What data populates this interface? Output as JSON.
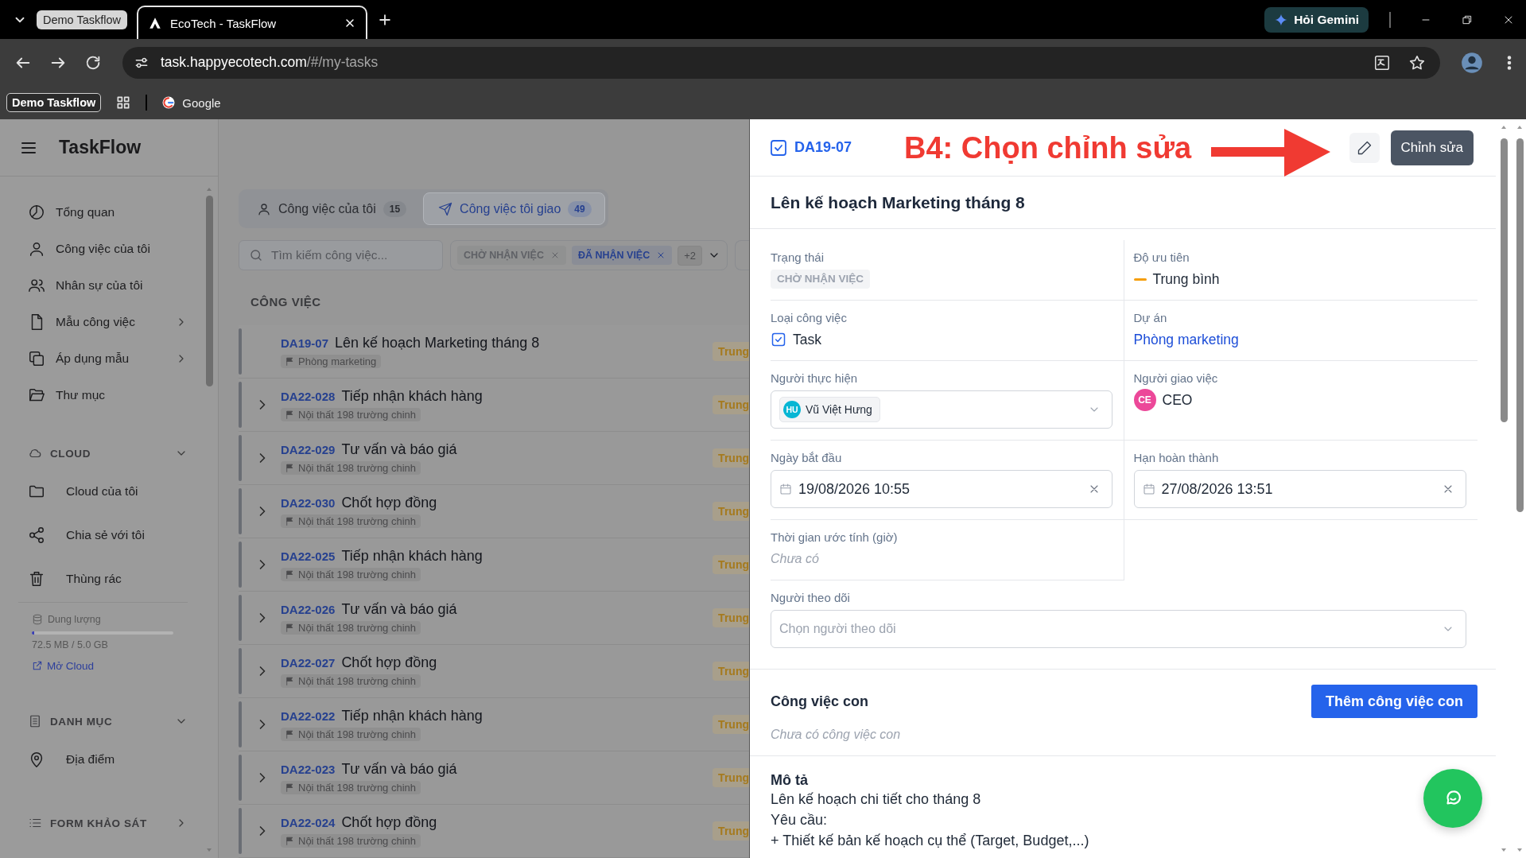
{
  "browser": {
    "tab_group": "Demo Taskflow",
    "tabs": [
      {
        "label": "EcoTech - TaskFlow",
        "selected": true
      }
    ],
    "gemini": "Hỏi Gemini",
    "url_host": "task.happyecotech.com",
    "url_path": "/#/my-tasks",
    "bookmark_group": "Demo Taskflow",
    "bookmarks": [
      {
        "label": "Google"
      }
    ]
  },
  "sidebar": {
    "title": "TaskFlow",
    "items": [
      {
        "label": "Tổng quan",
        "has_submenu": false
      },
      {
        "label": "Công việc của tôi",
        "has_submenu": false
      },
      {
        "label": "Nhân sự của tôi",
        "has_submenu": false
      },
      {
        "label": "Mẫu công việc",
        "has_submenu": true
      },
      {
        "label": "Áp dụng mẫu",
        "has_submenu": true
      },
      {
        "label": "Thư mục",
        "has_submenu": false
      }
    ],
    "cloud": {
      "title": "CLOUD",
      "expanded": true,
      "items": [
        "Cloud của tôi",
        "Chia sẻ với tôi",
        "Thùng rác"
      ],
      "storage": {
        "label": "Dung lượng",
        "level": 0.015,
        "reading": "72.5 MB / 5.0 GB",
        "link": "Mở Cloud"
      }
    },
    "catalog": {
      "title": "DANH MỤC",
      "expanded": true,
      "items": [
        "Địa điểm"
      ]
    },
    "survey": {
      "title": "FORM KHẢO SÁT",
      "expanded": false
    }
  },
  "task_list": {
    "view_tabs": [
      {
        "label": "Công việc của tôi",
        "count": "15",
        "selected": false
      },
      {
        "label": "Công việc tôi giao",
        "count": "49",
        "selected": true
      }
    ],
    "search": {
      "placeholder": "Tìm kiếm công việc..."
    },
    "status_filter": {
      "chips": [
        {
          "label": "CHỜ NHẬN VIỆC",
          "color": "#5f6166"
        },
        {
          "label": "ĐÃ NHẬN VIỆC",
          "color": "#27418f"
        }
      ],
      "more": "+2"
    },
    "header": "CÔNG VIỆC",
    "tasks": [
      {
        "code": "DA19-07",
        "title": "Lên kế hoạch Marketing tháng 8",
        "project": "Phòng marketing",
        "priority": "Trung",
        "has_children": false
      },
      {
        "code": "DA22-028",
        "title": "Tiếp nhận khách hàng",
        "project": "Nội thất 198 trường chinh",
        "priority": "Trung",
        "has_children": true
      },
      {
        "code": "DA22-029",
        "title": "Tư vấn và báo giá",
        "project": "Nội thất 198 trường chinh",
        "priority": "Trung",
        "has_children": true
      },
      {
        "code": "DA22-030",
        "title": "Chốt hợp đồng",
        "project": "Nội thất 198 trường chinh",
        "priority": "Trung",
        "has_children": true
      },
      {
        "code": "DA22-025",
        "title": "Tiếp nhận khách hàng",
        "project": "Nội thất 198 trường chinh",
        "priority": "Trung",
        "has_children": true
      },
      {
        "code": "DA22-026",
        "title": "Tư vấn và báo giá",
        "project": "Nội thất 198 trường chinh",
        "priority": "Trung",
        "has_children": true
      },
      {
        "code": "DA22-027",
        "title": "Chốt hợp đồng",
        "project": "Nội thất 198 trường chinh",
        "priority": "Trung",
        "has_children": true
      },
      {
        "code": "DA22-022",
        "title": "Tiếp nhận khách hàng",
        "project": "Nội thất 198 trường chinh",
        "priority": "Trung",
        "has_children": true
      },
      {
        "code": "DA22-023",
        "title": "Tư vấn và báo giá",
        "project": "Nội thất 198 trường chinh",
        "priority": "Trung",
        "has_children": true
      },
      {
        "code": "DA22-024",
        "title": "Chốt hợp đồng",
        "project": "Nội thất 198 trường chinh",
        "priority": "Trung",
        "has_children": true
      }
    ]
  },
  "detail": {
    "code": "DA19-07",
    "annotation": "B4: Chọn chỉnh sửa",
    "tooltip": "Chỉnh sửa",
    "title": "Lên kế hoạch Marketing tháng 8",
    "fields": [
      {
        "kind": "badge",
        "label": "Trạng thái",
        "value": "CHỜ NHẬN VIỆC"
      },
      {
        "kind": "priority",
        "label": "Độ ưu tiên",
        "value": "Trung bình"
      },
      {
        "kind": "type",
        "label": "Loại công việc",
        "value": "Task"
      },
      {
        "kind": "link",
        "label": "Dự án",
        "value": "Phòng marketing"
      },
      {
        "kind": "person-select",
        "label": "Người thực hiện",
        "initials": "HU",
        "value": "Vũ Việt Hưng",
        "color": "#06b6d4"
      },
      {
        "kind": "person",
        "label": "Người giao việc",
        "initials": "CE",
        "value": "CEO",
        "color": "#ec4899"
      },
      {
        "kind": "date",
        "label": "Ngày bắt đầu",
        "value": "19/08/2026 10:55"
      },
      {
        "kind": "date",
        "label": "Hạn hoàn thành",
        "value": "27/08/2026 13:51"
      },
      {
        "kind": "empty",
        "label": "Thời gian ước tính (giờ)",
        "value": "Chưa có"
      },
      {
        "kind": "select",
        "label": "Người theo dõi",
        "placeholder": "Chọn người theo dõi"
      }
    ],
    "subtasks": {
      "title": "Công việc con",
      "button": "Thêm công việc con",
      "empty": "Chưa có công việc con"
    },
    "description": {
      "title": "Mô tả",
      "lines": [
        "Lên kế hoạch chi tiết cho tháng 8",
        "Yêu cầu:",
        "+ Thiết kế bản kế hoạch cụ thể (Target, Budget,...)"
      ]
    }
  }
}
